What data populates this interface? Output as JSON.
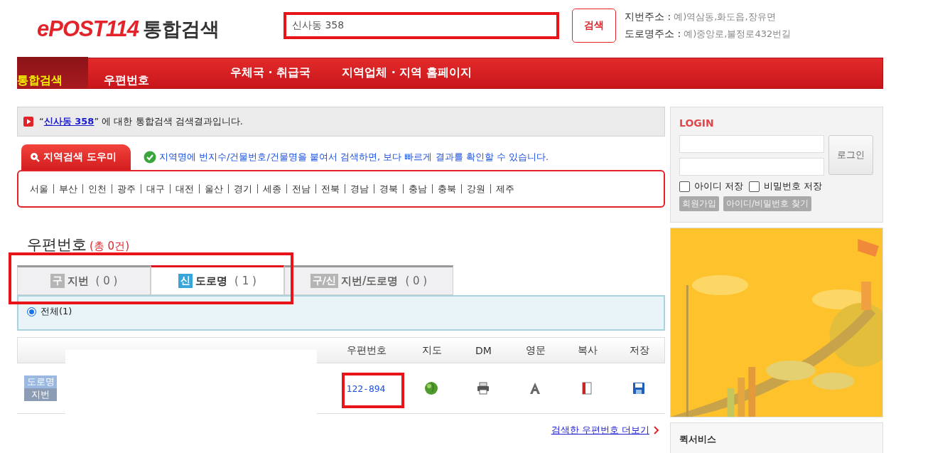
{
  "header": {
    "logo": "ePOST114",
    "title": "통합검색",
    "search": {
      "value": "신사동 358"
    },
    "search_button": "검색",
    "hints": [
      {
        "label": "지번주소 :",
        "example": "예)역삼동,화도읍,장유면"
      },
      {
        "label": "도로명주소 :",
        "example": "예)중앙로,불정로432번길"
      }
    ]
  },
  "nav": [
    {
      "label": "통합검색",
      "selected": true
    },
    {
      "label": "우편번호",
      "selected": false
    },
    {
      "label": "우체국 · 취급국",
      "selected": false
    },
    {
      "label": "지역업체 · 지역 홈페이지",
      "selected": false
    }
  ],
  "result_notice": {
    "open_quote": "“",
    "query": "신사동 358",
    "text": "” 에 대한 통합검색 검색결과입니다."
  },
  "region_helper": {
    "tab": "지역검색 도우미",
    "tip": "지역명에 번지수/건물번호/건물명을 붙여서 검색하면, 보다 빠르게 결과를 확인할 수 있습니다.",
    "regions": [
      "서울",
      "부산",
      "인천",
      "광주",
      "대구",
      "대전",
      "울산",
      "경기",
      "세종",
      "전남",
      "전북",
      "경남",
      "경북",
      "충남",
      "충북",
      "강원",
      "제주"
    ]
  },
  "postcode": {
    "title": "우편번호",
    "count": "(총 0건)",
    "tabs": [
      {
        "badge": "구",
        "label": "지번",
        "count": "( 0 )",
        "selected": false
      },
      {
        "badge": "신",
        "label": "도로명",
        "count": "( 1 )",
        "selected": true
      },
      {
        "badge": "구/신",
        "label": "지번/도로명",
        "count": "( 0 )",
        "selected": false
      }
    ],
    "filter": {
      "label": "전체(1)",
      "selected": true
    },
    "columns": [
      "우편번호",
      "지도",
      "DM",
      "영문",
      "복사",
      "저장"
    ],
    "rows": [
      {
        "badges": [
          "도로명",
          "지번"
        ],
        "postcode": "122-894"
      }
    ],
    "more_link": "검색한 우편번호 더보기"
  },
  "login": {
    "title": "LOGIN",
    "button": "로그인",
    "checks": [
      {
        "label": "아이디 저장",
        "checked": false
      },
      {
        "label": "비밀번호 저장",
        "checked": false
      }
    ],
    "links": [
      "회원가입",
      "아이디/비밀번호 찾기"
    ]
  },
  "quick": {
    "title": "퀵서비스"
  }
}
